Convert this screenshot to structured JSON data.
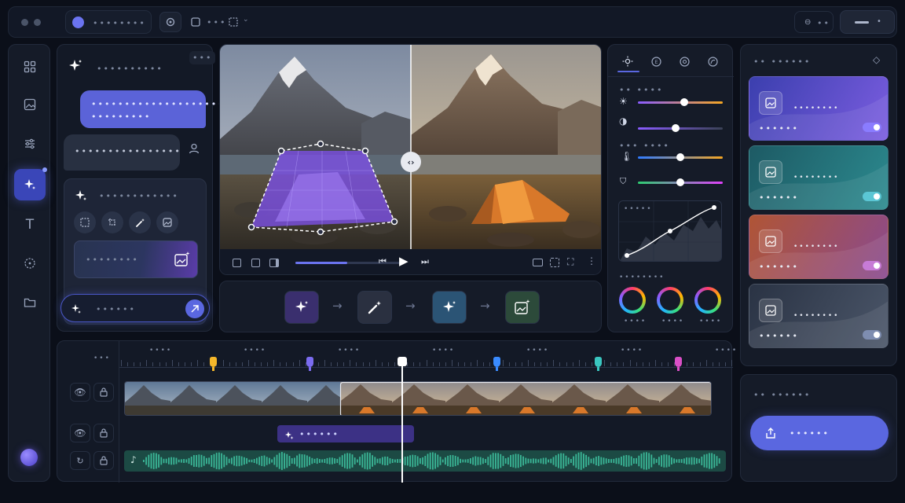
{
  "titlebar": {
    "window_controls": [
      "close",
      "minimize"
    ],
    "project_label": "••••••••",
    "tools_label": "•••",
    "right_label": "••",
    "far_right_label": "•"
  },
  "sidebar": {
    "items": [
      {
        "name": "grid-icon"
      },
      {
        "name": "image-icon"
      },
      {
        "name": "sliders-icon"
      },
      {
        "name": "sparkles-icon",
        "active": true
      },
      {
        "name": "text-icon"
      },
      {
        "name": "target-icon"
      },
      {
        "name": "folder-icon"
      }
    ]
  },
  "assistant": {
    "header_label": "••••••••••",
    "menu_label": "•••",
    "user_message_line1": "••••••••••••••••••••",
    "user_message_line2": "•••••••••",
    "assistant_message": "••••••••••••••••",
    "suggestion_title": "••••••••••••",
    "preview_label": "••••••••",
    "input_placeholder": "••••••"
  },
  "viewer": {
    "progress": 0.48,
    "toolbar_left": [
      "frame-icon",
      "crop-icon",
      "split-icon"
    ],
    "toolbar_right": [
      "aspect-icon",
      "fit-icon",
      "fullscreen-icon",
      "more-icon"
    ]
  },
  "workflow": {
    "steps": [
      "sparkles-icon",
      "magic-wand-icon",
      "sparkles-icon",
      "image-sparkle-icon"
    ],
    "colors": [
      "#3a2f6e",
      "#2a3040",
      "#2b5475",
      "#2c4a3a"
    ]
  },
  "adjustments": {
    "tabs": [
      "sun-icon",
      "exposure-icon",
      "color-icon",
      "curve-icon"
    ],
    "section_label": "•• •••• ••••",
    "sliders": [
      {
        "icon": "brightness-icon",
        "value": 0.55,
        "color_from": "#8a5cff",
        "color_to": "#f5a623"
      },
      {
        "icon": "contrast-icon",
        "value": 0.44,
        "color_from": "#8a5cff",
        "color_to": "#3a4256"
      },
      {
        "icon": "temperature-icon",
        "value": 0.5,
        "color_from": "#2f7bff",
        "color_to": "#f5a623"
      },
      {
        "icon": "tint-icon",
        "value": 0.5,
        "color_from": "#2ecc71",
        "color_to": "#e040fb"
      }
    ],
    "slider_group_labels": [
      "•• ••••",
      "••• ••••"
    ],
    "curve_label": "•••••",
    "wheels_label": "••••••••",
    "wheel_labels": [
      "••••",
      "••••",
      "••••"
    ]
  },
  "styles": {
    "header_label": "•• ••••••",
    "cards": [
      {
        "label": "••••••••",
        "sublabel": "••••••",
        "color_from": "#3b3fae",
        "color_to": "#7b5de0",
        "toggle_color": "#8a7cff"
      },
      {
        "label": "••••••••",
        "sublabel": "••••••",
        "color_from": "#1d5a64",
        "color_to": "#2c8a8f",
        "toggle_color": "#5bc6d4"
      },
      {
        "label": "••••••••",
        "sublabel": "••••••",
        "color_from": "#b05535",
        "color_to": "#8a4a8f",
        "toggle_color": "#c77bd6"
      },
      {
        "label": "••••••••",
        "sublabel": "••••••",
        "color_from": "#2a3344",
        "color_to": "#4b5669",
        "toggle_color": "#7e8db0"
      }
    ]
  },
  "export": {
    "header_label": "•• ••••••",
    "button_label": "••••••",
    "button_color": "#5a67e0"
  },
  "timeline": {
    "track_label": "•••",
    "ruler_labels": [
      "••••",
      "••••",
      "••••",
      "••••",
      "••••",
      "••••",
      "••••"
    ],
    "markers": [
      {
        "color": "#f5b72a",
        "position": 0.153
      },
      {
        "color": "#7b6cf0",
        "position": 0.31
      },
      {
        "color": "#3a8bff",
        "position": 0.614
      },
      {
        "color": "#3ac6c0",
        "position": 0.78
      },
      {
        "color": "#d94fc6",
        "position": 0.91
      }
    ],
    "playhead": 0.46,
    "ai_clip_label": "••••••",
    "audio_color": "#1c4a44"
  },
  "colors": {
    "accent": "#5a67e0",
    "panel": "#151b28",
    "background": "#0b0f19"
  }
}
